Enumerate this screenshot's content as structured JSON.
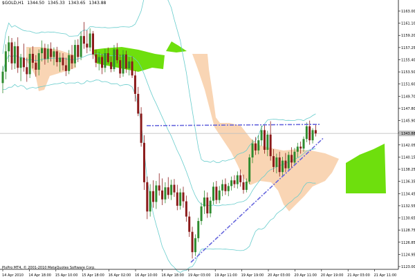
{
  "window": {
    "symbol_label": "$GOLD,H1",
    "ohlc": [
      "1344.50",
      "1345.33",
      "1343.65",
      "1343.88"
    ],
    "footer_text": "PlxPro MT4, © 2001-2010 MetaQuotes Software Corp."
  },
  "colors": {
    "background": "#ffffff",
    "candle_bull": "#2e8b2e",
    "candle_bear": "#8b1a1a",
    "cloud_bull": "#66dd00",
    "cloud_bear": "#f9d3b0",
    "bands": "#66cccc",
    "trend_line": "#6666dd",
    "current_price_line": "#c0c0c0",
    "axis": "#000000"
  },
  "chart_data": {
    "type": "candlestick",
    "price_axis_labels": [
      "1163.00",
      "1161.10",
      "1159.20",
      "1157.25",
      "1155.40",
      "1153.50",
      "1151.60",
      "1149.70",
      "1147.80",
      "1145.90",
      "1143.88",
      "1142.05",
      "1140.15",
      "1138.25",
      "1136.35",
      "1134.45",
      "1132.55",
      "1130.65",
      "1128.75",
      "1126.85",
      "1124.95",
      "1123.00"
    ],
    "time_axis_labels": [
      "14 Apr 2010",
      "14 Apr 18:00",
      "15 Apr 10:00",
      "15 Apr 18:00",
      "16 Apr 02:00",
      "16 Apr 10:00",
      "16 Apr 18:00",
      "19 Apr 03:00",
      "19 Apr 11:00",
      "19 Apr 19:00",
      "20 Apr 03:00",
      "20 Apr 11:00",
      "20 Apr 19:00",
      "21 Apr 03:00",
      "21 Apr 11:00"
    ],
    "ylim": [
      1122.5,
      1164.0
    ],
    "current_price": 1143.88,
    "candles": [
      {
        "o": 1151.8,
        "h": 1154.5,
        "l": 1150.2,
        "c": 1153.6
      },
      {
        "o": 1153.6,
        "h": 1157.9,
        "l": 1152.4,
        "c": 1156.8
      },
      {
        "o": 1156.8,
        "h": 1159.2,
        "l": 1155.1,
        "c": 1158.2
      },
      {
        "o": 1158.2,
        "h": 1158.9,
        "l": 1153.9,
        "c": 1154.9
      },
      {
        "o": 1154.9,
        "h": 1158.3,
        "l": 1154.0,
        "c": 1157.6
      },
      {
        "o": 1157.6,
        "h": 1159.0,
        "l": 1153.4,
        "c": 1154.2
      },
      {
        "o": 1154.2,
        "h": 1156.4,
        "l": 1152.1,
        "c": 1155.8
      },
      {
        "o": 1155.8,
        "h": 1158.0,
        "l": 1153.6,
        "c": 1154.3
      },
      {
        "o": 1154.3,
        "h": 1155.8,
        "l": 1152.0,
        "c": 1153.2
      },
      {
        "o": 1153.2,
        "h": 1157.3,
        "l": 1152.6,
        "c": 1156.4
      },
      {
        "o": 1156.4,
        "h": 1157.6,
        "l": 1154.1,
        "c": 1155.0
      },
      {
        "o": 1155.0,
        "h": 1156.2,
        "l": 1152.8,
        "c": 1153.9
      },
      {
        "o": 1153.9,
        "h": 1157.1,
        "l": 1153.0,
        "c": 1156.5
      },
      {
        "o": 1156.5,
        "h": 1158.5,
        "l": 1155.2,
        "c": 1157.3
      },
      {
        "o": 1157.3,
        "h": 1158.0,
        "l": 1154.7,
        "c": 1155.6
      },
      {
        "o": 1155.6,
        "h": 1157.9,
        "l": 1155.0,
        "c": 1157.2
      },
      {
        "o": 1157.2,
        "h": 1158.2,
        "l": 1155.2,
        "c": 1155.9
      },
      {
        "o": 1155.9,
        "h": 1157.4,
        "l": 1154.6,
        "c": 1156.8
      },
      {
        "o": 1156.8,
        "h": 1157.5,
        "l": 1154.4,
        "c": 1155.1
      },
      {
        "o": 1155.1,
        "h": 1156.6,
        "l": 1153.6,
        "c": 1155.8
      },
      {
        "o": 1155.8,
        "h": 1156.5,
        "l": 1153.8,
        "c": 1154.6
      },
      {
        "o": 1154.6,
        "h": 1155.8,
        "l": 1152.9,
        "c": 1153.7
      },
      {
        "o": 1153.7,
        "h": 1157.0,
        "l": 1153.2,
        "c": 1156.2
      },
      {
        "o": 1156.2,
        "h": 1157.8,
        "l": 1154.0,
        "c": 1154.9
      },
      {
        "o": 1154.9,
        "h": 1158.6,
        "l": 1154.3,
        "c": 1157.8
      },
      {
        "o": 1157.8,
        "h": 1158.7,
        "l": 1155.1,
        "c": 1155.9
      },
      {
        "o": 1155.9,
        "h": 1159.9,
        "l": 1155.4,
        "c": 1159.2
      },
      {
        "o": 1159.2,
        "h": 1161.4,
        "l": 1157.2,
        "c": 1158.0
      },
      {
        "o": 1158.0,
        "h": 1160.1,
        "l": 1156.5,
        "c": 1157.4
      },
      {
        "o": 1157.4,
        "h": 1160.4,
        "l": 1156.8,
        "c": 1159.6
      },
      {
        "o": 1159.6,
        "h": 1160.0,
        "l": 1155.6,
        "c": 1156.3
      },
      {
        "o": 1156.3,
        "h": 1157.1,
        "l": 1154.3,
        "c": 1155.0
      },
      {
        "o": 1155.0,
        "h": 1156.7,
        "l": 1153.8,
        "c": 1155.9
      },
      {
        "o": 1155.9,
        "h": 1156.4,
        "l": 1153.2,
        "c": 1154.2
      },
      {
        "o": 1154.2,
        "h": 1157.2,
        "l": 1153.5,
        "c": 1156.5
      },
      {
        "o": 1156.5,
        "h": 1157.4,
        "l": 1154.8,
        "c": 1155.1
      },
      {
        "o": 1155.1,
        "h": 1156.0,
        "l": 1153.5,
        "c": 1154.0
      },
      {
        "o": 1154.0,
        "h": 1157.8,
        "l": 1153.6,
        "c": 1157.1
      },
      {
        "o": 1157.1,
        "h": 1158.1,
        "l": 1154.9,
        "c": 1155.4
      },
      {
        "o": 1155.4,
        "h": 1156.3,
        "l": 1152.6,
        "c": 1153.3
      },
      {
        "o": 1153.3,
        "h": 1157.0,
        "l": 1152.8,
        "c": 1156.3
      },
      {
        "o": 1156.3,
        "h": 1156.9,
        "l": 1153.4,
        "c": 1154.1
      },
      {
        "o": 1154.1,
        "h": 1155.9,
        "l": 1153.0,
        "c": 1155.2
      },
      {
        "o": 1155.2,
        "h": 1156.0,
        "l": 1152.6,
        "c": 1153.0
      },
      {
        "o": 1153.0,
        "h": 1153.8,
        "l": 1148.9,
        "c": 1150.1
      },
      {
        "o": 1150.1,
        "h": 1151.2,
        "l": 1146.6,
        "c": 1147.0
      },
      {
        "o": 1147.0,
        "h": 1148.0,
        "l": 1141.8,
        "c": 1142.4
      },
      {
        "o": 1142.4,
        "h": 1143.6,
        "l": 1135.0,
        "c": 1136.2
      },
      {
        "o": 1136.2,
        "h": 1137.1,
        "l": 1130.4,
        "c": 1131.6
      },
      {
        "o": 1131.6,
        "h": 1135.9,
        "l": 1130.8,
        "c": 1134.8
      },
      {
        "o": 1134.8,
        "h": 1136.5,
        "l": 1132.2,
        "c": 1133.1
      },
      {
        "o": 1133.1,
        "h": 1136.4,
        "l": 1132.0,
        "c": 1135.7
      },
      {
        "o": 1135.7,
        "h": 1137.6,
        "l": 1134.1,
        "c": 1134.9
      },
      {
        "o": 1134.9,
        "h": 1136.8,
        "l": 1132.6,
        "c": 1133.5
      },
      {
        "o": 1133.5,
        "h": 1136.2,
        "l": 1132.9,
        "c": 1135.4
      },
      {
        "o": 1135.4,
        "h": 1137.0,
        "l": 1133.6,
        "c": 1134.2
      },
      {
        "o": 1134.2,
        "h": 1136.6,
        "l": 1133.4,
        "c": 1135.8
      },
      {
        "o": 1135.8,
        "h": 1136.7,
        "l": 1133.9,
        "c": 1134.6
      },
      {
        "o": 1134.6,
        "h": 1135.8,
        "l": 1131.8,
        "c": 1132.5
      },
      {
        "o": 1132.5,
        "h": 1135.2,
        "l": 1131.9,
        "c": 1134.6
      },
      {
        "o": 1134.6,
        "h": 1135.5,
        "l": 1132.2,
        "c": 1133.2
      },
      {
        "o": 1133.2,
        "h": 1134.1,
        "l": 1130.0,
        "c": 1130.8
      },
      {
        "o": 1130.8,
        "h": 1131.6,
        "l": 1127.6,
        "c": 1128.4
      },
      {
        "o": 1128.4,
        "h": 1129.2,
        "l": 1124.2,
        "c": 1125.2
      },
      {
        "o": 1125.2,
        "h": 1128.0,
        "l": 1124.6,
        "c": 1127.4
      },
      {
        "o": 1127.4,
        "h": 1130.6,
        "l": 1126.8,
        "c": 1130.1
      },
      {
        "o": 1130.1,
        "h": 1133.0,
        "l": 1129.5,
        "c": 1132.4
      },
      {
        "o": 1132.4,
        "h": 1134.9,
        "l": 1131.2,
        "c": 1133.8
      },
      {
        "o": 1133.8,
        "h": 1134.6,
        "l": 1130.6,
        "c": 1131.3
      },
      {
        "o": 1131.3,
        "h": 1133.9,
        "l": 1130.7,
        "c": 1133.3
      },
      {
        "o": 1133.3,
        "h": 1136.2,
        "l": 1132.7,
        "c": 1135.5
      },
      {
        "o": 1135.5,
        "h": 1136.4,
        "l": 1132.8,
        "c": 1133.4
      },
      {
        "o": 1133.4,
        "h": 1135.6,
        "l": 1132.9,
        "c": 1134.9
      },
      {
        "o": 1134.9,
        "h": 1136.6,
        "l": 1134.0,
        "c": 1135.9
      },
      {
        "o": 1135.9,
        "h": 1136.8,
        "l": 1134.2,
        "c": 1134.8
      },
      {
        "o": 1134.8,
        "h": 1136.1,
        "l": 1134.0,
        "c": 1135.6
      },
      {
        "o": 1135.6,
        "h": 1137.1,
        "l": 1134.9,
        "c": 1136.5
      },
      {
        "o": 1136.5,
        "h": 1137.3,
        "l": 1135.3,
        "c": 1135.9
      },
      {
        "o": 1135.9,
        "h": 1137.9,
        "l": 1135.2,
        "c": 1137.3
      },
      {
        "o": 1137.3,
        "h": 1138.2,
        "l": 1135.5,
        "c": 1136.2
      },
      {
        "o": 1136.2,
        "h": 1137.4,
        "l": 1134.4,
        "c": 1135.0
      },
      {
        "o": 1135.0,
        "h": 1136.8,
        "l": 1134.6,
        "c": 1136.3
      },
      {
        "o": 1136.3,
        "h": 1140.6,
        "l": 1135.9,
        "c": 1140.1
      },
      {
        "o": 1140.1,
        "h": 1142.9,
        "l": 1139.2,
        "c": 1142.3
      },
      {
        "o": 1142.3,
        "h": 1143.3,
        "l": 1140.5,
        "c": 1141.2
      },
      {
        "o": 1141.2,
        "h": 1143.6,
        "l": 1140.6,
        "c": 1142.8
      },
      {
        "o": 1142.8,
        "h": 1145.1,
        "l": 1141.9,
        "c": 1144.4
      },
      {
        "o": 1144.4,
        "h": 1145.2,
        "l": 1140.7,
        "c": 1141.3
      },
      {
        "o": 1141.3,
        "h": 1144.3,
        "l": 1140.3,
        "c": 1143.7
      },
      {
        "o": 1143.7,
        "h": 1145.8,
        "l": 1139.6,
        "c": 1140.3
      },
      {
        "o": 1140.3,
        "h": 1141.4,
        "l": 1137.8,
        "c": 1138.6
      },
      {
        "o": 1138.6,
        "h": 1140.7,
        "l": 1137.6,
        "c": 1140.1
      },
      {
        "o": 1140.1,
        "h": 1141.0,
        "l": 1137.1,
        "c": 1137.8
      },
      {
        "o": 1137.8,
        "h": 1140.2,
        "l": 1137.2,
        "c": 1139.6
      },
      {
        "o": 1139.6,
        "h": 1140.8,
        "l": 1137.8,
        "c": 1138.4
      },
      {
        "o": 1138.4,
        "h": 1141.0,
        "l": 1138.0,
        "c": 1140.5
      },
      {
        "o": 1140.5,
        "h": 1141.7,
        "l": 1138.4,
        "c": 1139.3
      },
      {
        "o": 1139.3,
        "h": 1141.6,
        "l": 1138.8,
        "c": 1141.0
      },
      {
        "o": 1141.0,
        "h": 1142.4,
        "l": 1140.1,
        "c": 1141.8
      },
      {
        "o": 1141.8,
        "h": 1142.6,
        "l": 1140.7,
        "c": 1141.5
      },
      {
        "o": 1141.5,
        "h": 1143.4,
        "l": 1141.0,
        "c": 1143.0
      },
      {
        "o": 1143.0,
        "h": 1145.6,
        "l": 1142.5,
        "c": 1145.0
      },
      {
        "o": 1145.0,
        "h": 1145.9,
        "l": 1142.1,
        "c": 1142.8
      },
      {
        "o": 1142.8,
        "h": 1144.7,
        "l": 1142.3,
        "c": 1144.4
      },
      {
        "o": 1144.4,
        "h": 1145.3,
        "l": 1143.4,
        "c": 1143.88
      }
    ]
  }
}
